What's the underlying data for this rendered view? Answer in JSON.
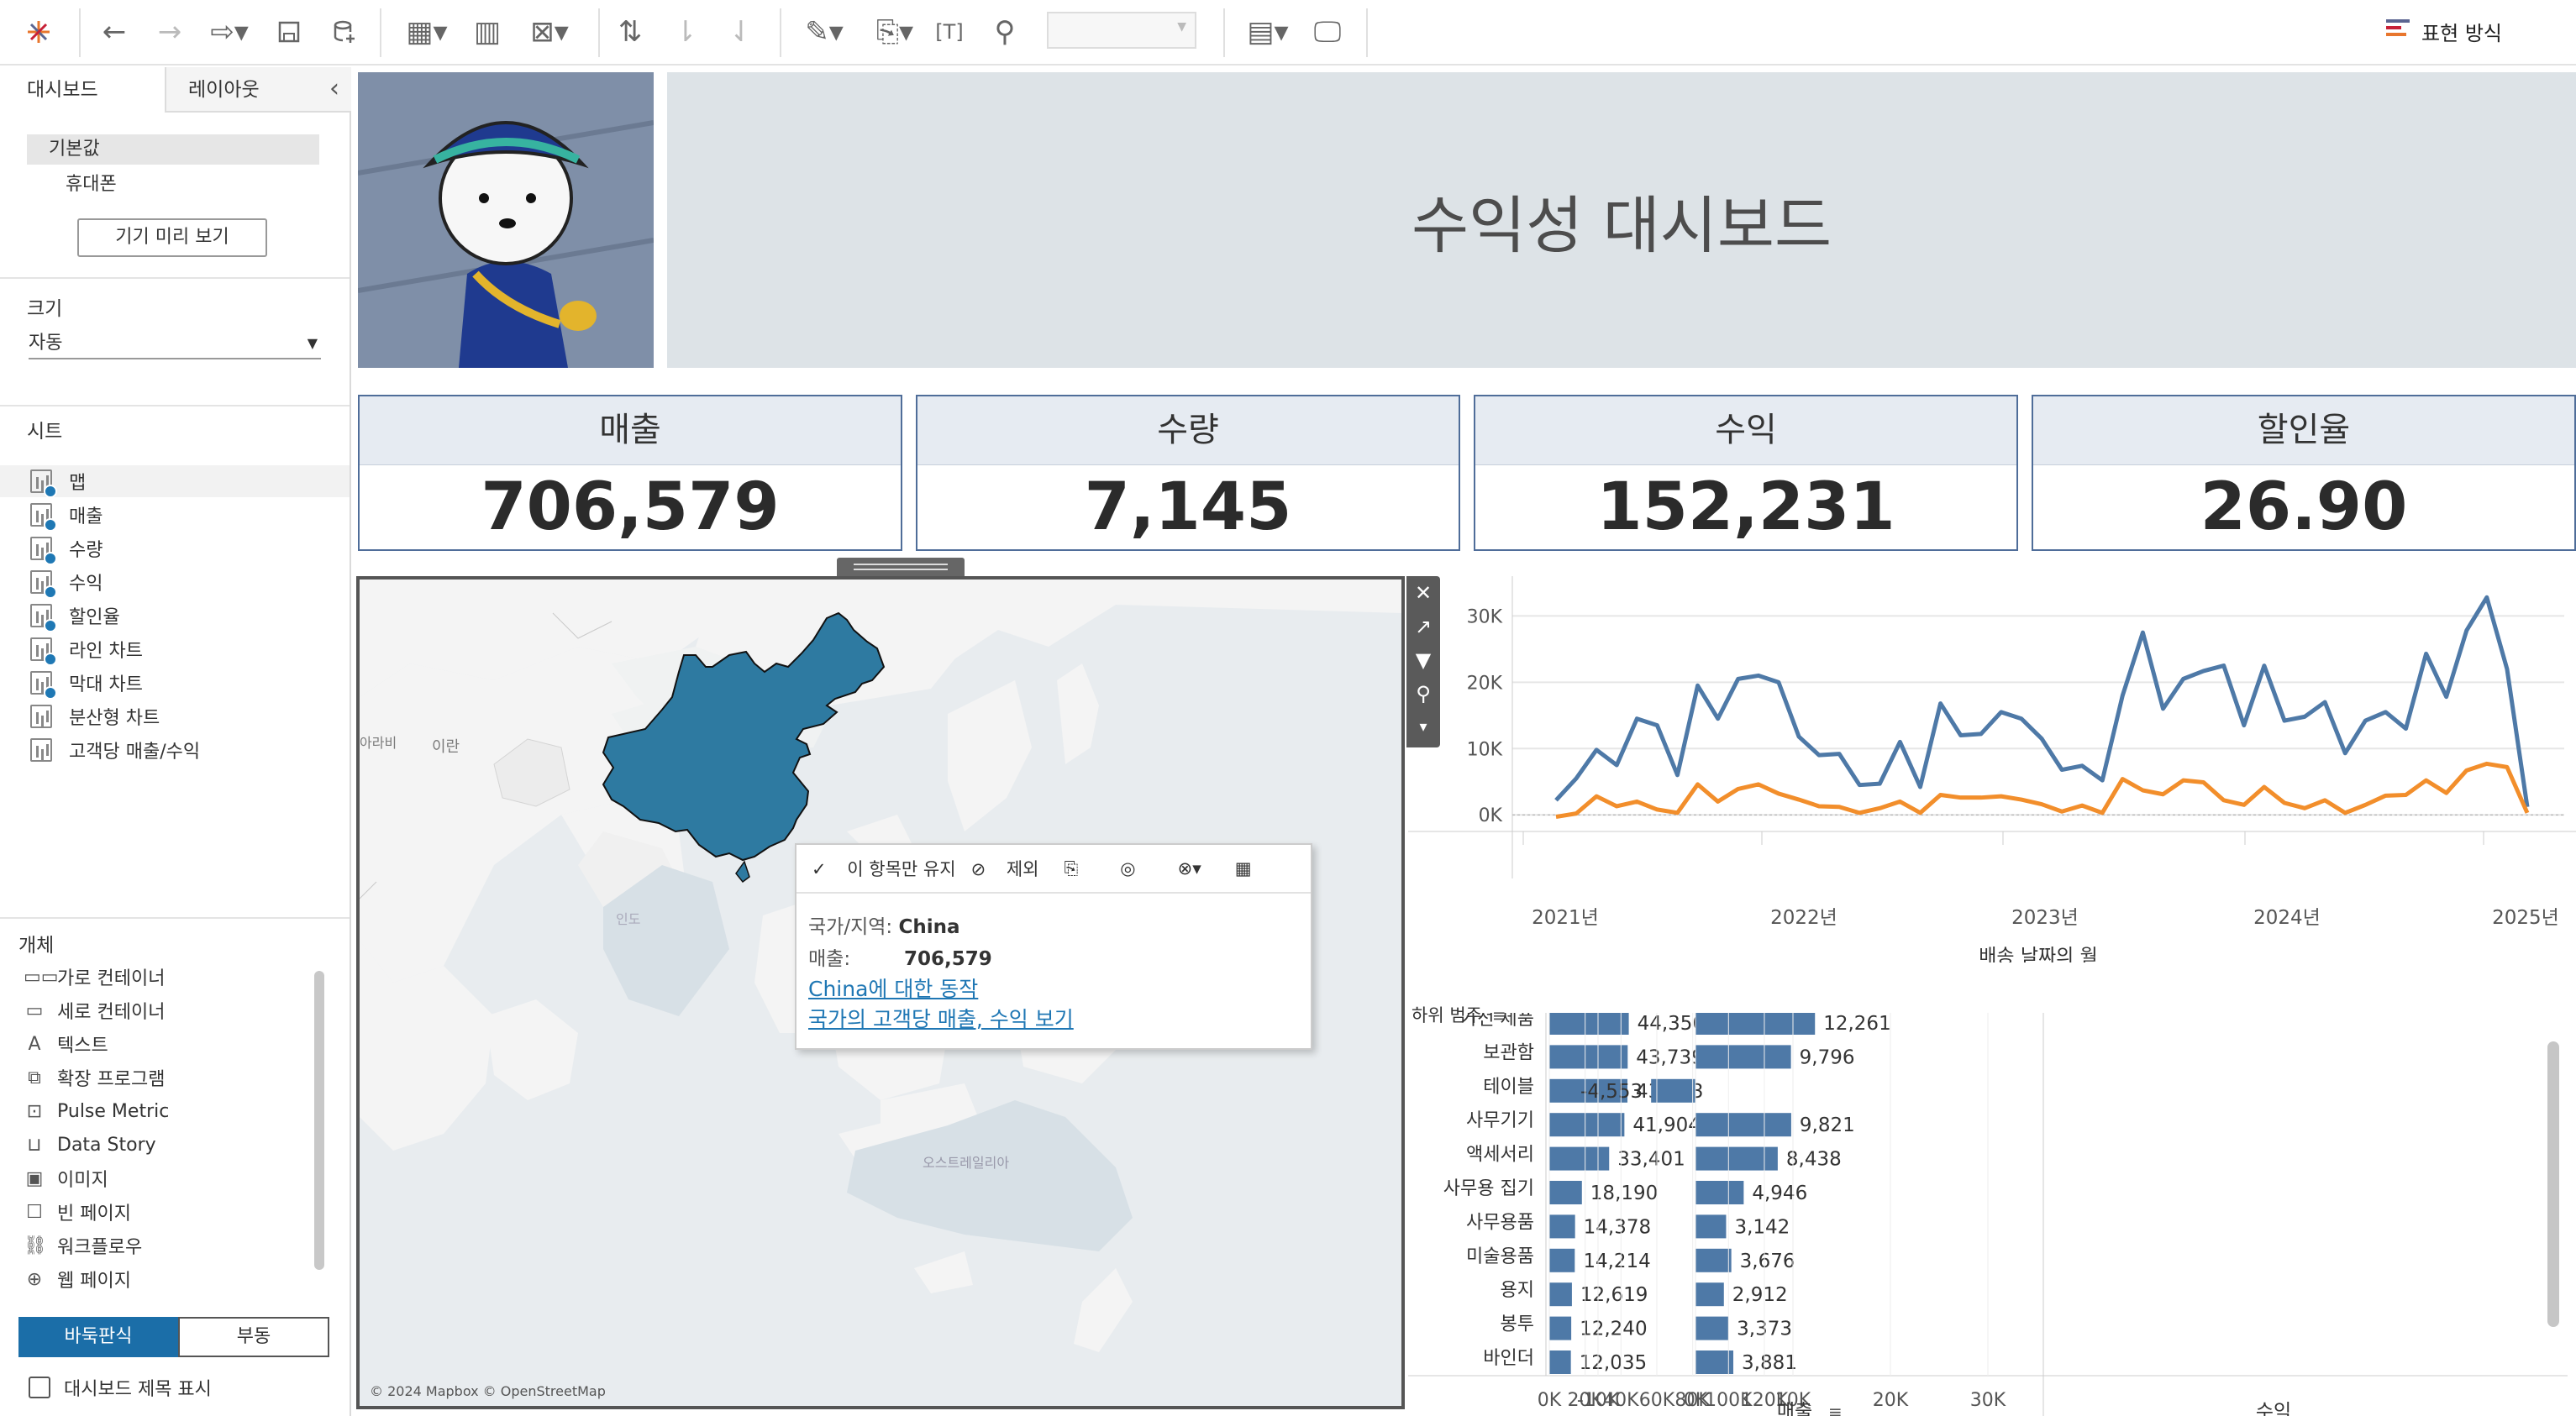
{
  "toolbar": {
    "show_me_label": "표현 방식"
  },
  "sidebar": {
    "tabs": {
      "dashboard": "대시보드",
      "layout": "레이아웃"
    },
    "device": {
      "default": "기본값",
      "phone": "휴대폰",
      "preview_button": "기기 미리 보기"
    },
    "size": {
      "title": "크기",
      "value": "자동"
    },
    "sheets": {
      "title": "시트",
      "items": [
        "맵",
        "매출",
        "수량",
        "수익",
        "할인율",
        "라인 차트",
        "막대 차트",
        "분산형 차트",
        "고객당 매출/수익"
      ]
    },
    "objects": {
      "title": "개체",
      "items": [
        "가로 컨테이너",
        "세로 컨테이너",
        "텍스트",
        "확장 프로그램",
        "Pulse Metric",
        "Data Story",
        "이미지",
        "빈 페이지",
        "워크플로우",
        "웹 페이지"
      ]
    },
    "layout_mode": {
      "tiled": "바둑판식",
      "floating": "부동"
    },
    "show_title": "대시보드 제목 표시"
  },
  "dashboard": {
    "title": "수익성 대시보드",
    "kpis": [
      {
        "label": "매출",
        "value": "706,579"
      },
      {
        "label": "수량",
        "value": "7,145"
      },
      {
        "label": "수익",
        "value": "152,231"
      },
      {
        "label": "할인율",
        "value": "26.90"
      }
    ]
  },
  "map": {
    "labels": {
      "iran": "이란",
      "arabia": "아라비",
      "india": "인도",
      "australia": "오스트레일리아"
    },
    "attribution": "© 2024 Mapbox © OpenStreetMap",
    "tooltip": {
      "keep_only": "이 항목만 유지",
      "exclude": "제외",
      "country_label": "국가/지역:",
      "country_value": "China",
      "sales_label": "매출:",
      "sales_value": "706,579",
      "link1": "China에 대한 동작",
      "link2": "국가의 고객당 매출, 수익 보기"
    }
  },
  "chart_data": [
    {
      "type": "line",
      "xlabel": "배송 날짜의 월",
      "x_ticks": [
        "2021년",
        "2022년",
        "2023년",
        "2024년",
        "2025년"
      ],
      "y_ticks": [
        "0K",
        "10K",
        "20K",
        "30K"
      ],
      "ylim": [
        -2000,
        36000
      ],
      "series": [
        {
          "color": "#4e79a7",
          "values": [
            2200,
            5500,
            9800,
            7500,
            14500,
            13500,
            6000,
            19500,
            14500,
            20500,
            21000,
            20000,
            11800,
            9000,
            9200,
            4500,
            4700,
            11000,
            4200,
            16800,
            12000,
            12200,
            15500,
            14500,
            11500,
            6800,
            7400,
            5200,
            18000,
            27500,
            16000,
            20500,
            21700,
            22500,
            13500,
            22500,
            14200,
            14800,
            17000,
            9300,
            14200,
            15500,
            13000,
            24300,
            17800,
            27800,
            32800,
            22000,
            1200
          ]
        },
        {
          "color": "#f28e2b",
          "values": [
            -300,
            200,
            2800,
            1300,
            2000,
            800,
            300,
            4600,
            2000,
            3900,
            4600,
            3200,
            2300,
            1300,
            1200,
            300,
            1000,
            2000,
            300,
            3000,
            2600,
            2600,
            2800,
            2300,
            1600,
            500,
            1400,
            300,
            5400,
            3700,
            3100,
            5200,
            4900,
            2200,
            1500,
            4200,
            1800,
            1000,
            2200,
            300,
            1500,
            2900,
            3000,
            5200,
            3300,
            6700,
            7700,
            7200,
            300
          ]
        }
      ]
    },
    {
      "type": "bar",
      "header": "하위 범주",
      "categories": [
        "가전 제품",
        "보관함",
        "테이블",
        "사무기기",
        "액세서리",
        "사무용 집기",
        "사무용품",
        "미술용품",
        "용지",
        "봉투",
        "바인더"
      ],
      "series": [
        {
          "name": "매출",
          "values": [
            44350,
            43739,
            43613,
            41904,
            33401,
            18190,
            14378,
            14214,
            12619,
            12240,
            12035
          ],
          "labels": [
            "44,350",
            "43,739",
            "43,613",
            "41,904",
            "33,401",
            "18,190",
            "14,378",
            "14,214",
            "12,619",
            "12,240",
            "12,035"
          ],
          "ticks": [
            "0K",
            "20K",
            "40K",
            "60K",
            "80K",
            "100K",
            "120K"
          ]
        },
        {
          "name": "수익",
          "values": [
            12261,
            9796,
            -4553,
            9821,
            8438,
            4946,
            3142,
            3676,
            2912,
            3373,
            3881
          ],
          "labels": [
            "12,261",
            "9,796",
            "-4,553",
            "9,821",
            "8,438",
            "4,946",
            "3,142",
            "3,676",
            "2,912",
            "3,373",
            "3,881"
          ],
          "ticks": [
            "-10K",
            "0K",
            "10K",
            "20K",
            "30K"
          ]
        }
      ],
      "color": "#4e79a7"
    }
  ]
}
